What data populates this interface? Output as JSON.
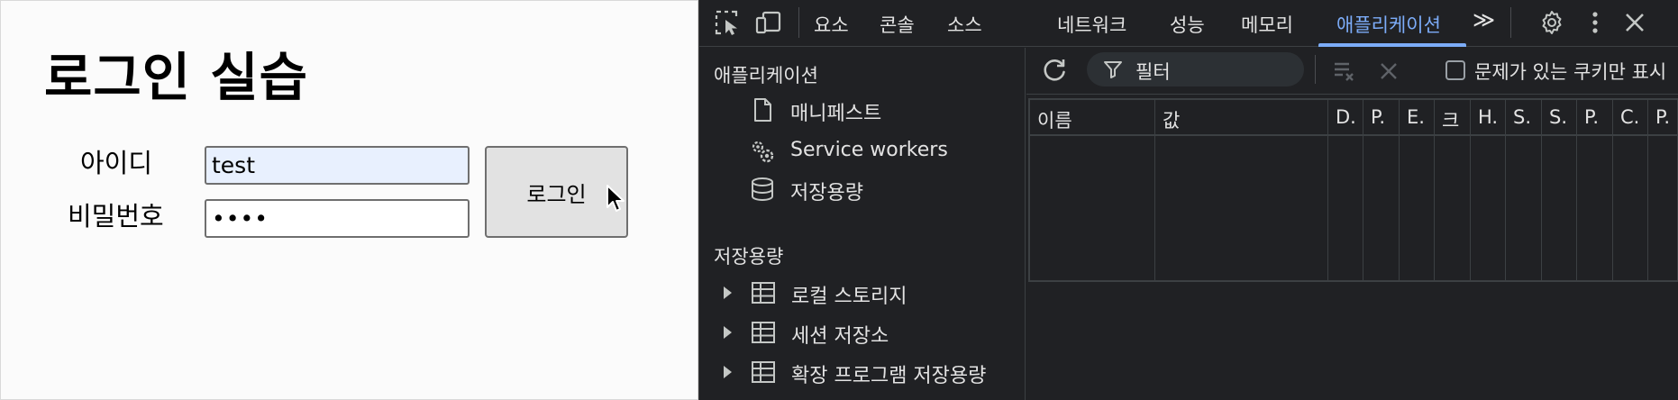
{
  "page": {
    "title": "로그인 실습",
    "id_label": "아이디",
    "pw_label": "비밀번호",
    "id_value": "test",
    "pw_value": "••••",
    "login_button": "로그인"
  },
  "devtools": {
    "tabs": [
      {
        "label": "요소"
      },
      {
        "label": "콘솔"
      },
      {
        "label": "소스"
      },
      {
        "label": "네트워크"
      },
      {
        "label": "성능"
      },
      {
        "label": "메모리"
      },
      {
        "label": "애플리케이션",
        "active": true
      }
    ],
    "more_tabs": "≫",
    "accent_color": "#7cacf8",
    "sidebar": {
      "application_title": "애플리케이션",
      "application_items": [
        {
          "label": "매니페스트",
          "icon": "document-icon"
        },
        {
          "label": "Service workers",
          "icon": "gears-icon"
        },
        {
          "label": "저장용량",
          "icon": "database-icon"
        }
      ],
      "storage_title": "저장용량",
      "storage_items": [
        {
          "label": "로컬 스토리지",
          "icon": "table-icon"
        },
        {
          "label": "세션 저장소",
          "icon": "table-icon"
        },
        {
          "label": "확장 프로그램 저장용량",
          "icon": "table-icon"
        }
      ]
    },
    "cookies": {
      "filter_placeholder": "필터",
      "only_issues_label": "문제가 있는 쿠키만 표시",
      "columns": [
        "이름",
        "값",
        "D.",
        "P.",
        "E.",
        "크",
        "H.",
        "S.",
        "S.",
        "P.",
        "C.",
        "P."
      ]
    }
  }
}
